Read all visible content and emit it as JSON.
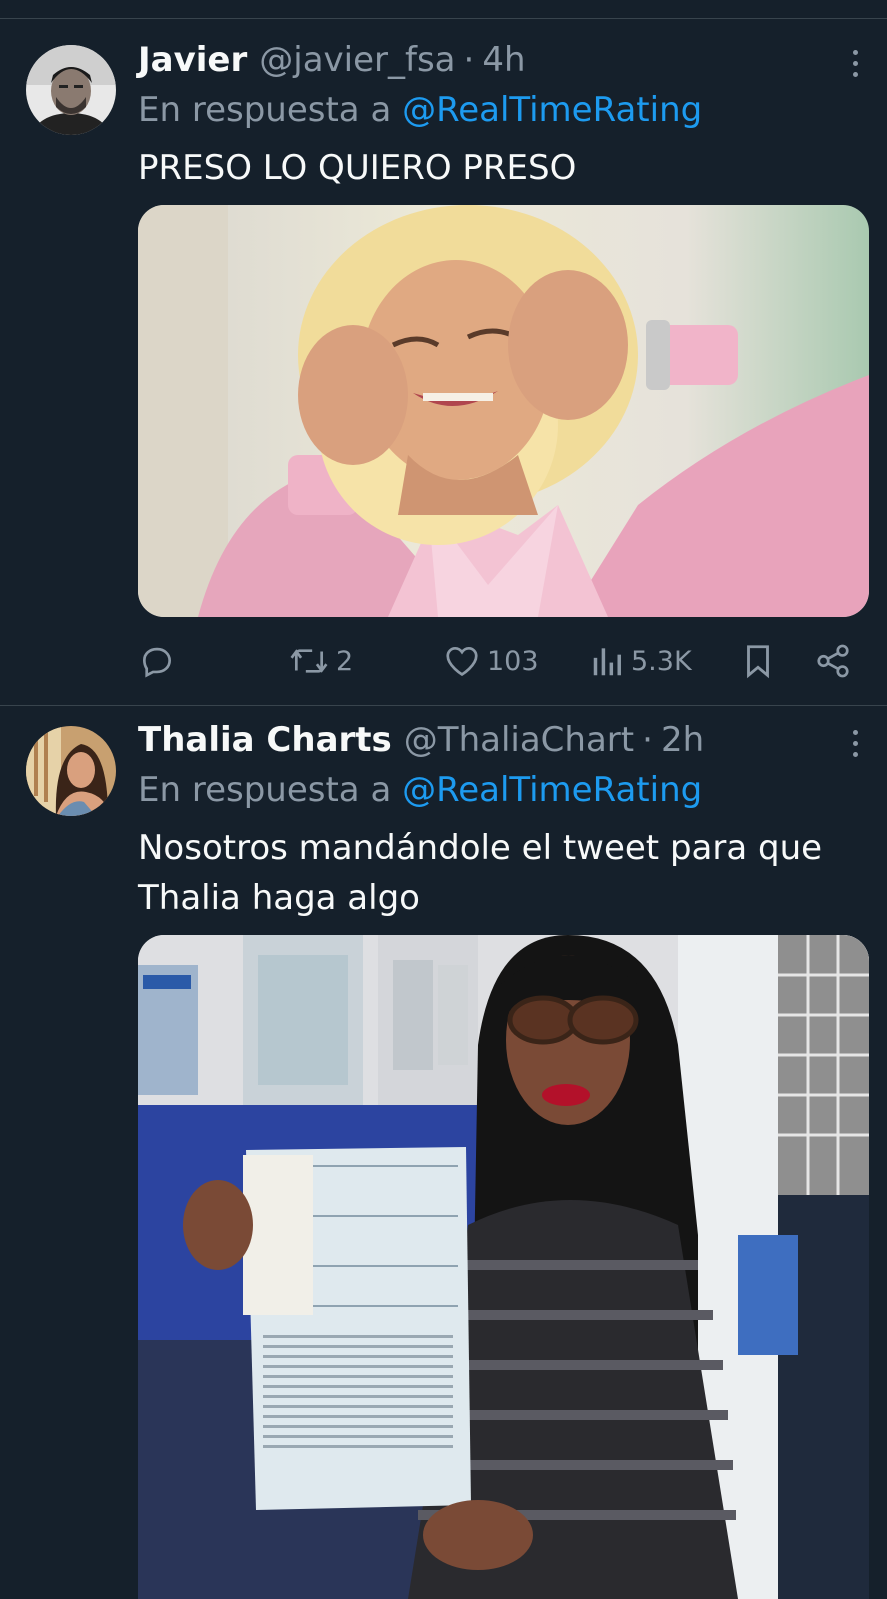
{
  "tweets": [
    {
      "author_name": "Javier",
      "author_handle": "@javier_fsa",
      "dot": "·",
      "time": "4h",
      "reply_prefix": "En respuesta a",
      "reply_to": "@RealTimeRating",
      "text": "PRESO LO QUIERO PRESO",
      "media": "photo: blonde woman in pink lace jacket holding her head",
      "stats": {
        "replies": "",
        "retweets": "2",
        "likes": "103",
        "views": "5.3K"
      }
    },
    {
      "author_name": "Thalia Charts",
      "author_handle": "@ThaliaChart",
      "dot": "·",
      "time": "2h",
      "reply_prefix": "En respuesta a",
      "reply_to": "@RealTimeRating",
      "text": "Nosotros mandándole el tweet para que Thalia haga algo",
      "media": "photo: woman with sunglasses holding a document in an office"
    }
  ],
  "icons": {
    "reply": "reply-icon",
    "retweet": "retweet-icon",
    "like": "heart-icon",
    "views": "views-icon",
    "bookmark": "bookmark-icon",
    "share": "share-icon",
    "more": "more-icon"
  },
  "colors": {
    "background": "#15202b",
    "mention": "#1d9bf0",
    "secondary_text": "#8b98a5",
    "divider": "#38444d"
  }
}
